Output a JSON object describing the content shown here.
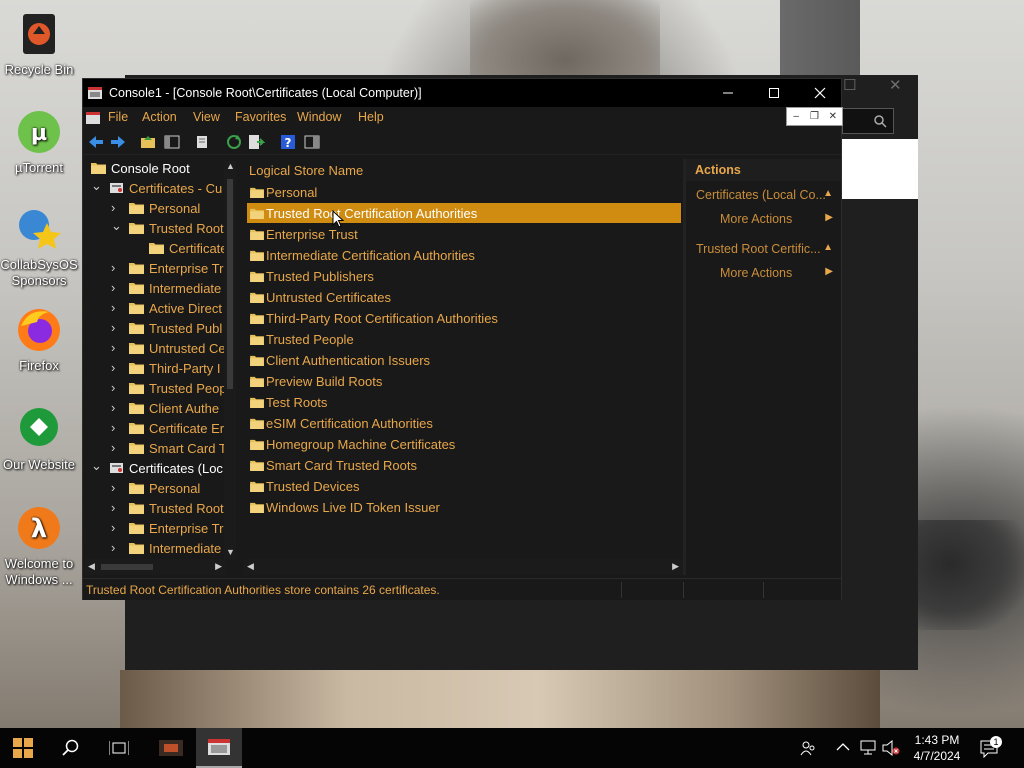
{
  "desktop": {
    "icons": [
      {
        "label": "Recycle Bin"
      },
      {
        "label": "µTorrent"
      },
      {
        "label": "CollabSysOS Sponsors"
      },
      {
        "label": "Firefox"
      },
      {
        "label": "Our Website"
      },
      {
        "label": "Welcome to Windows ..."
      }
    ]
  },
  "window": {
    "title": "Console1 - [Console Root\\Certificates (Local Computer)]",
    "menu": [
      "File",
      "Action",
      "View",
      "Favorites",
      "Window",
      "Help"
    ]
  },
  "tree": {
    "items": [
      {
        "label": "Console Root",
        "level": 0,
        "chevron": "",
        "selected": true
      },
      {
        "label": "Certificates - Cu",
        "level": 1,
        "chevron": "down"
      },
      {
        "label": "Personal",
        "level": 2,
        "chevron": "right"
      },
      {
        "label": "Trusted Root",
        "level": 2,
        "chevron": "down"
      },
      {
        "label": "Certificate",
        "level": 3,
        "chevron": ""
      },
      {
        "label": "Enterprise Tr",
        "level": 2,
        "chevron": "right"
      },
      {
        "label": "Intermediate",
        "level": 2,
        "chevron": "right"
      },
      {
        "label": "Active Direct",
        "level": 2,
        "chevron": "right"
      },
      {
        "label": "Trusted Publ",
        "level": 2,
        "chevron": "right"
      },
      {
        "label": "Untrusted Ce",
        "level": 2,
        "chevron": "right"
      },
      {
        "label": "Third-Party I",
        "level": 2,
        "chevron": "right"
      },
      {
        "label": "Trusted Peop",
        "level": 2,
        "chevron": "right"
      },
      {
        "label": "Client Authe",
        "level": 2,
        "chevron": "right"
      },
      {
        "label": "Certificate Er",
        "level": 2,
        "chevron": "right"
      },
      {
        "label": "Smart Card T",
        "level": 2,
        "chevron": "right"
      },
      {
        "label": "Certificates (Loc",
        "level": 1,
        "chevron": "down",
        "white": true
      },
      {
        "label": "Personal",
        "level": 2,
        "chevron": "right"
      },
      {
        "label": "Trusted Root",
        "level": 2,
        "chevron": "right"
      },
      {
        "label": "Enterprise Tr",
        "level": 2,
        "chevron": "right"
      },
      {
        "label": "Intermediate",
        "level": 2,
        "chevron": "right"
      }
    ]
  },
  "list": {
    "header": "Logical Store Name",
    "selected_index": 1,
    "items": [
      "Personal",
      "Trusted Root Certification Authorities",
      "Enterprise Trust",
      "Intermediate Certification Authorities",
      "Trusted Publishers",
      "Untrusted Certificates",
      "Third-Party Root Certification Authorities",
      "Trusted People",
      "Client Authentication Issuers",
      "Preview Build Roots",
      "Test Roots",
      "eSIM Certification Authorities",
      "Homegroup Machine Certificates",
      "Smart Card Trusted Roots",
      "Trusted Devices",
      "Windows Live ID Token Issuer"
    ]
  },
  "actions": {
    "header": "Actions",
    "rows": [
      {
        "label": "Certificates (Local Co...",
        "type": "section"
      },
      {
        "label": "More Actions",
        "type": "sub"
      },
      {
        "label": "Trusted Root Certific...",
        "type": "section"
      },
      {
        "label": "More Actions",
        "type": "sub"
      }
    ]
  },
  "status": {
    "text": "Trusted Root Certification Authorities store contains 26 certificates."
  },
  "clock": {
    "time": "1:43 PM",
    "date": "4/7/2024"
  },
  "colors": {
    "accent": "#e8a74a",
    "selection": "#d08c11",
    "window_bg": "#191919"
  }
}
